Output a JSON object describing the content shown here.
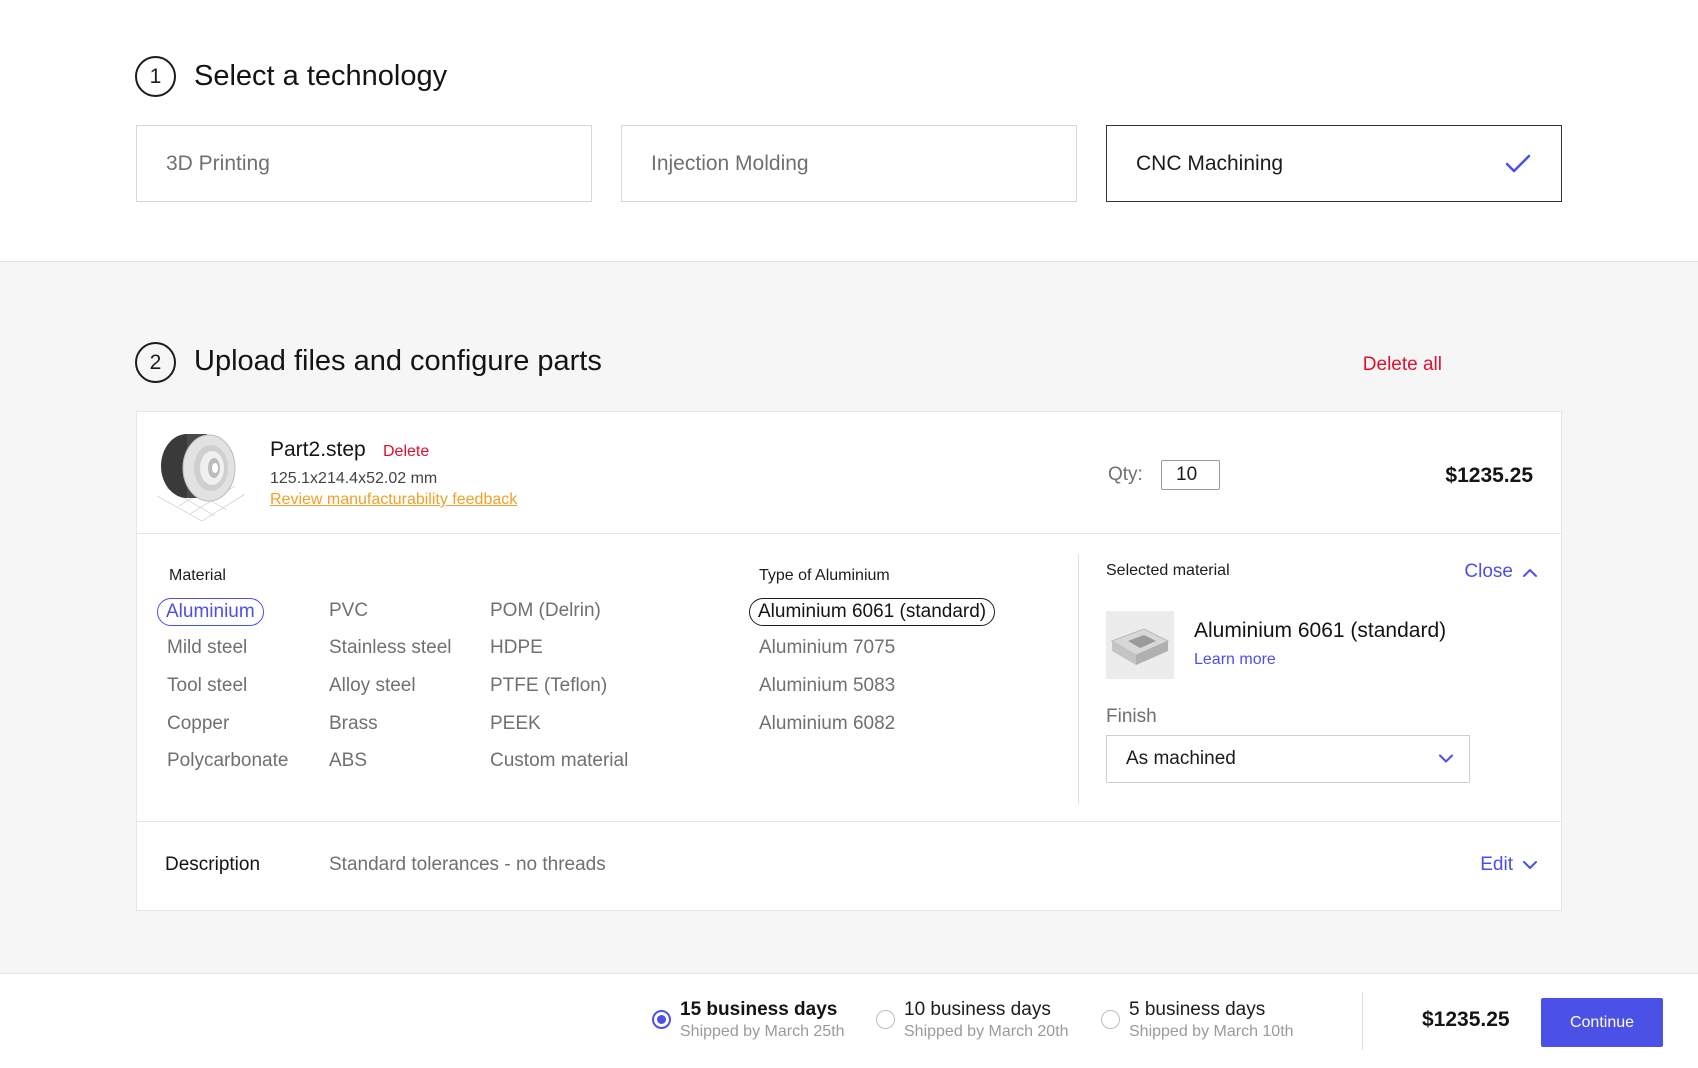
{
  "step1": {
    "number": "1",
    "title": "Select a technology",
    "options": [
      {
        "label": "3D Printing",
        "selected": false
      },
      {
        "label": "Injection Molding",
        "selected": false
      },
      {
        "label": "CNC Machining",
        "selected": true
      }
    ]
  },
  "step2": {
    "number": "2",
    "title": "Upload files and configure parts",
    "delete_all": "Delete all"
  },
  "part": {
    "name": "Part2.step",
    "delete": "Delete",
    "dimensions": "125.1x214.4x52.02 mm",
    "feedback_link": "Review manufacturability feedback",
    "qty_label": "Qty:",
    "qty_value": "10",
    "price": "$1235.25"
  },
  "materials": {
    "heading": "Material",
    "columns": [
      [
        "Aluminium",
        "Mild steel",
        "Tool steel",
        "Copper",
        "Polycarbonate"
      ],
      [
        "PVC",
        "Stainless steel",
        "Alloy steel",
        "Brass",
        "ABS"
      ],
      [
        "POM (Delrin)",
        "HDPE",
        "PTFE (Teflon)",
        "PEEK",
        "Custom material"
      ]
    ],
    "selected": "Aluminium"
  },
  "aluminium_types": {
    "heading": "Type of Aluminium",
    "items": [
      "Aluminium 6061 (standard)",
      "Aluminium 7075",
      "Aluminium 5083",
      "Aluminium 6082"
    ],
    "selected": "Aluminium 6061 (standard)"
  },
  "selected_material": {
    "heading": "Selected material",
    "close": "Close",
    "name": "Aluminium 6061 (standard)",
    "learn_more": "Learn more",
    "finish_label": "Finish",
    "finish_value": "As machined"
  },
  "description": {
    "label": "Description",
    "text": "Standard tolerances - no threads",
    "edit": "Edit"
  },
  "shipping": {
    "options": [
      {
        "title": "15 business days",
        "sub": "Shipped by March 25th",
        "selected": true
      },
      {
        "title": "10 business days",
        "sub": "Shipped by March 20th",
        "selected": false
      },
      {
        "title": "5 business days",
        "sub": "Shipped by March 10th",
        "selected": false
      }
    ],
    "total": "$1235.25",
    "continue": "Continue"
  },
  "colors": {
    "accent": "#4b50e6",
    "danger": "#e0102f",
    "warning_link": "#f0a028",
    "section_bg": "#f6f6f6"
  }
}
